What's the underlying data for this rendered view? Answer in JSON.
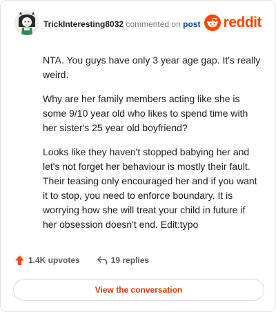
{
  "comment": {
    "username": "TrickInteresting8032",
    "action_text": "commented on",
    "post_link_text": "post",
    "paragraphs": [
      "NTA. You guys have only 3 year age gap. It's really weird.",
      "Why are her family members acting like she is some 9/10 year old who likes to spend time with her sister's 25 year old boyfriend?",
      "Looks like they haven't stopped babying her and let's not forget her behaviour is mostly their fault. Their teasing only encouraged her and if you want it to stop, you need to enforce boundary. It is worrying how she will treat your child in future if her obsession doesn't end. Edit:typo"
    ]
  },
  "brand": {
    "name": "reddit",
    "icon": "reddit-logo-icon",
    "color": "#ff4500"
  },
  "stats": {
    "upvotes": "1.4K upvotes",
    "upvote_icon": "upvote-arrow-icon",
    "replies": "19 replies",
    "reply_icon": "reply-arrow-icon"
  },
  "cta": {
    "label": "View the conversation"
  },
  "colors": {
    "accent": "#ff4500",
    "link": "#0045ac",
    "button_text": "#d93900"
  }
}
